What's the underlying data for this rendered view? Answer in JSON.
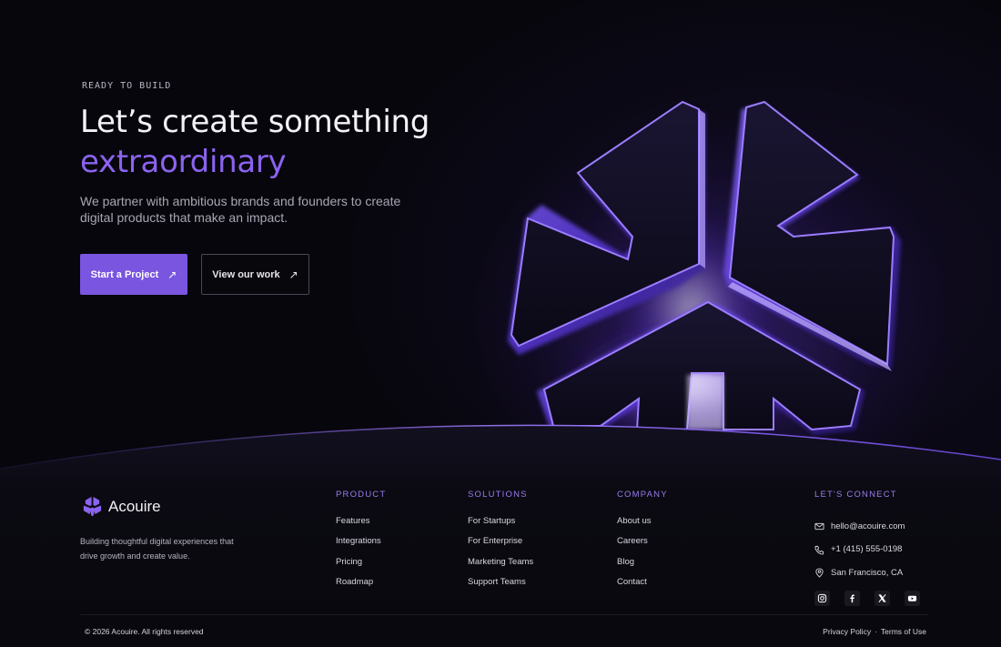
{
  "hero": {
    "eyebrow": "READY TO BUILD",
    "headline_line1": "Let’s create something",
    "headline_accent": "extraordinary",
    "subcopy": "We partner with ambitious brands and founders to create digital products that make an impact.",
    "primary_cta": "Start a Project",
    "secondary_cta": "View our work",
    "arrow": "↗"
  },
  "brand": {
    "name": "Acouire",
    "description": "Building thoughtful digital experiences that drive growth and create value."
  },
  "footer": {
    "product": {
      "title": "PRODUCT",
      "links": [
        "Features",
        "Integrations",
        "Pricing",
        "Roadmap"
      ]
    },
    "solutions": {
      "title": "SOLUTIONS",
      "links": [
        "For Startups",
        "For Enterprise",
        "Marketing Teams",
        "Support Teams"
      ]
    },
    "company": {
      "title": "COMPANY",
      "links": [
        "About us",
        "Careers",
        "Blog",
        "Contact"
      ]
    },
    "connect": {
      "title": "LET'S CONNECT",
      "email": "hello@acouire.com",
      "phone": "+1 (415) 555-0198",
      "location": "San Francisco, CA",
      "socials": [
        "instagram-icon",
        "facebook-icon",
        "x-icon",
        "youtube-icon"
      ]
    },
    "copyright": "© 2026 Acouire. All rights reserved",
    "privacy": "Privacy Policy",
    "separator": "·",
    "terms": "Terms of Use"
  },
  "colors": {
    "accent": "#8b63f0",
    "button": "#7a55e0",
    "background": "#07060c"
  }
}
